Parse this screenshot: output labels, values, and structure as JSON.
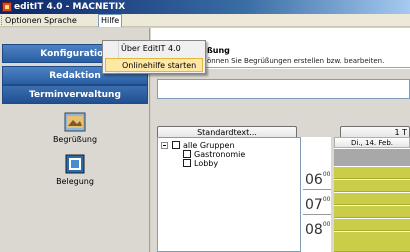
{
  "window": {
    "title": "editIT 4.0 - MACNETIX"
  },
  "menubar": {
    "items": [
      "Optionen",
      "Sprache",
      "Hilfe"
    ]
  },
  "help_menu": {
    "items": [
      "Über EditIT 4.0",
      "Onlinehilfe starten"
    ],
    "highlighted": "Onlinehilfe starten"
  },
  "sidebar": {
    "nav": [
      "Konfiguration",
      "Redaktion",
      "Terminverwaltung"
    ],
    "tools": [
      {
        "label": "Begrüßung",
        "icon": "greeting-icon"
      },
      {
        "label": "Belegung",
        "icon": "occupancy-icon"
      }
    ]
  },
  "header": {
    "title": "ßung",
    "subtitle": "önnen Sie Begrüßungen erstellen bzw. bearbeiten."
  },
  "content": {
    "text_value": "",
    "standard_button": "Standardtext...",
    "second_button": "1 T",
    "tree": {
      "root": "alle Gruppen",
      "children": [
        "Gastronomie",
        "Lobby"
      ]
    },
    "times": [
      "06",
      "07",
      "08"
    ],
    "time_minutes": "00",
    "day_header": "Di., 14. Feb."
  },
  "colors": {
    "nav_blue": "#2a5ea2",
    "slot_yellow": "#c9cd47",
    "highlight": "#ffe8a6"
  }
}
